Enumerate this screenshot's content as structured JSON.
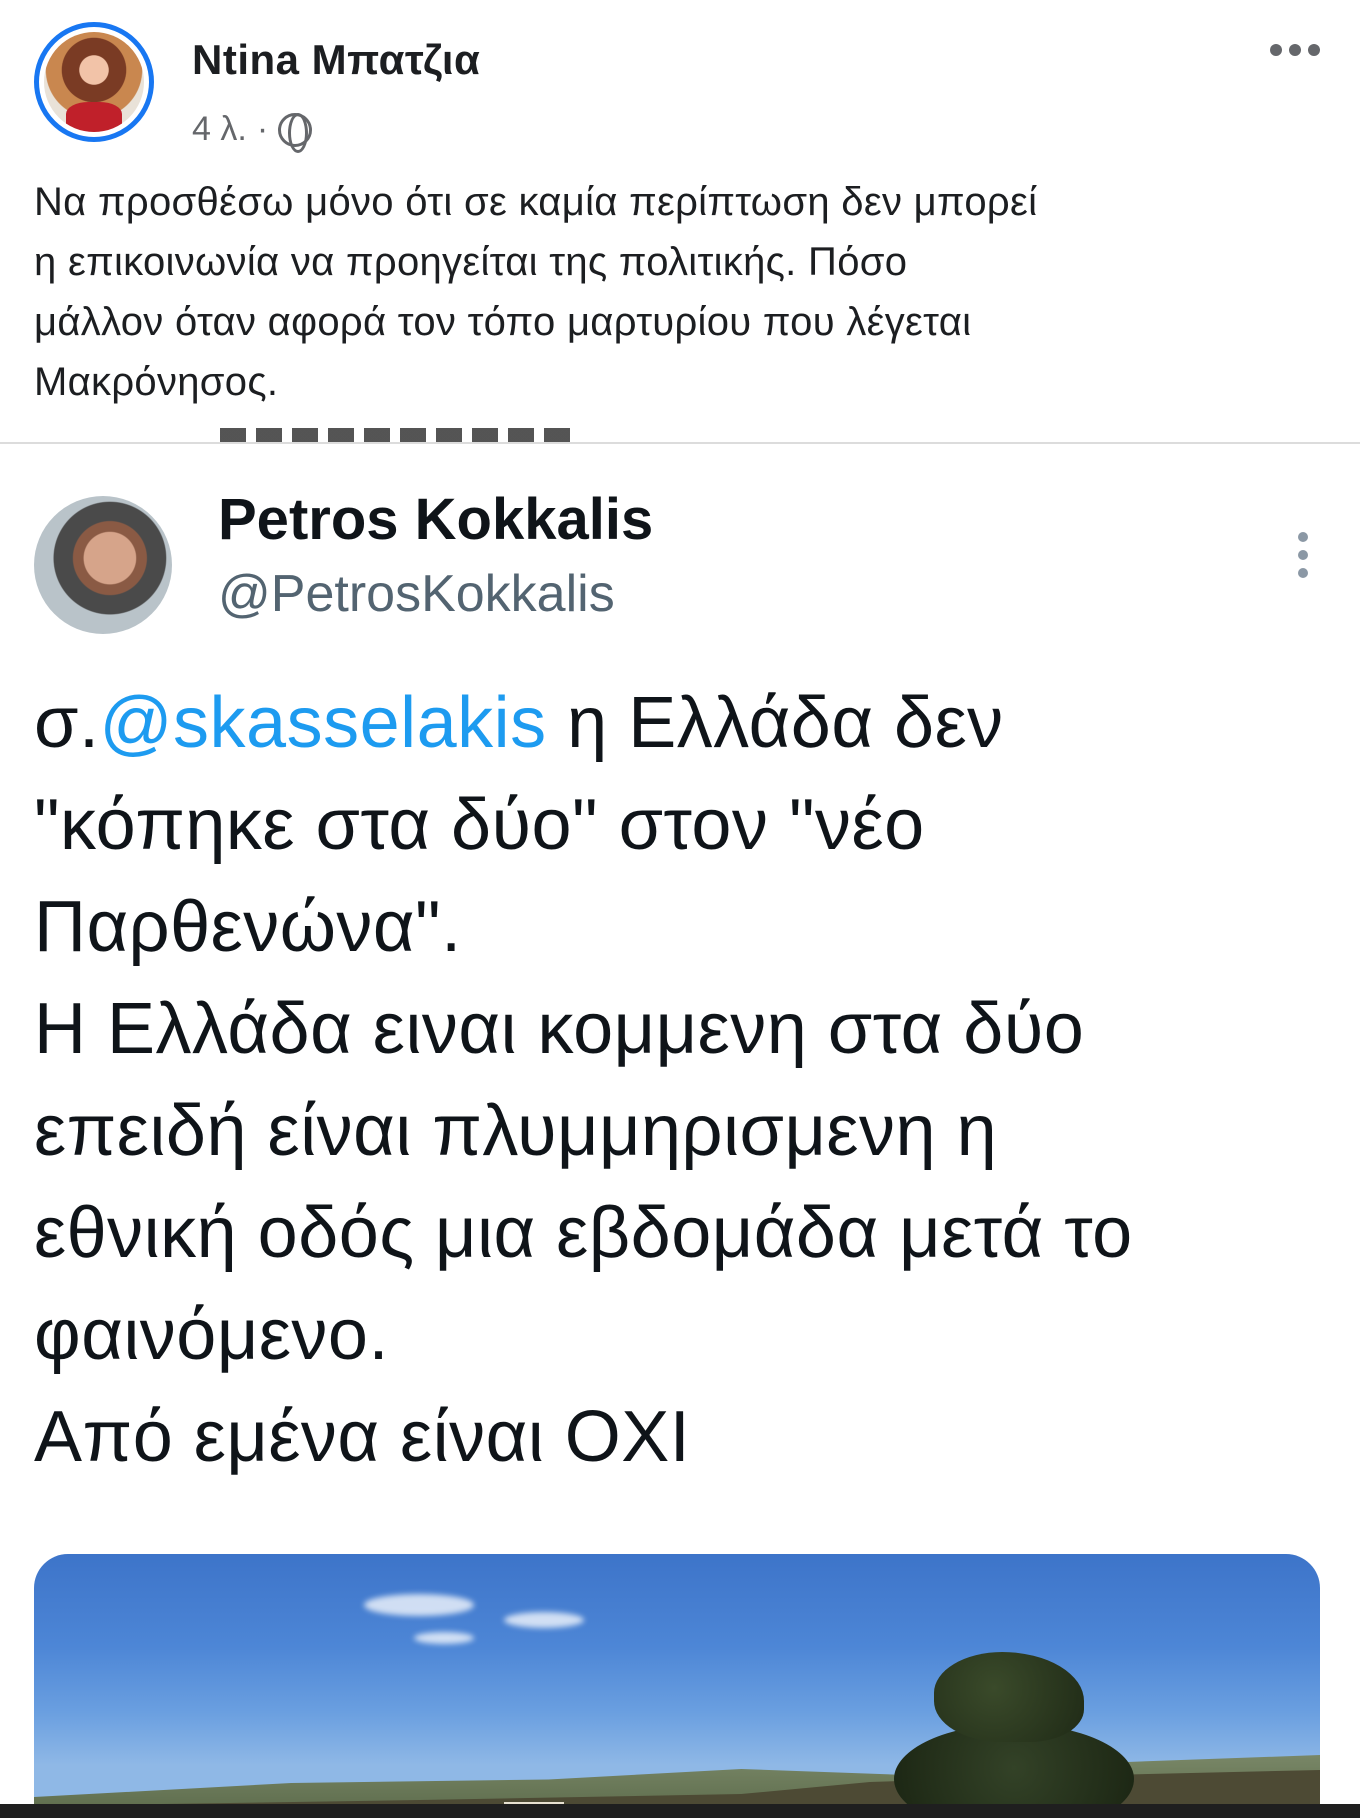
{
  "facebook_post": {
    "author_name": "Ntina Μπατζια",
    "time_ago": "4 λ.",
    "separator": "·",
    "audience_icon": "globe-icon",
    "more_icon": "more-horizontal-icon",
    "text_lines": [
      "Να προσθέσω μόνο ότι σε καμία περίπτωση δεν μπορεί",
      "η επικοινωνία να προηγείται της πολιτικής. Πόσο",
      "μάλλον όταν αφορά τον τόπο μαρτυρίου που λέγεται",
      "Μακρόνησος."
    ],
    "link_color": "#1877f2"
  },
  "tweet": {
    "author_name": "Petros Kokkalis",
    "handle": "@PetrosKokkalis",
    "more_icon": "more-vertical-icon",
    "body": {
      "prefix": "σ.",
      "mention": "@skasselakis",
      "line1_rest": " η Ελλάδα δεν",
      "line2": "\"κόπηκε στα δύο\" στον \"νέο",
      "line3": "Παρθενώνα\".",
      "line4": "Η Ελλάδα ειναι κομμενη στα δύο",
      "line5": "επειδή είναι πλυμμηρισμενη η",
      "line6": "εθνική οδός μια εβδομάδα μετά το",
      "line7": "φαινόμενο.",
      "line8": "Από εμένα είναι ΟΧΙ"
    },
    "mention_color": "#1d9bf0"
  }
}
